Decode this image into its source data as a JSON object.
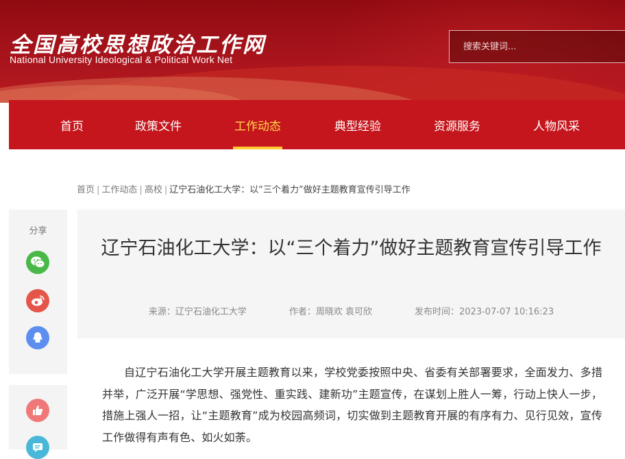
{
  "header": {
    "logo_cn": "全国高校思想政治工作网",
    "logo_en": "National University Ideological & Political Work Net",
    "search_placeholder": "搜索关键词..."
  },
  "nav": {
    "items": [
      {
        "label": "首页"
      },
      {
        "label": "政策文件"
      },
      {
        "label": "工作动态",
        "active": true
      },
      {
        "label": "典型经验"
      },
      {
        "label": "资源服务"
      },
      {
        "label": "人物风采"
      }
    ],
    "active_color": "#ffd84a",
    "bar_color": "#c5161d"
  },
  "breadcrumb": {
    "home": "首页",
    "section": "工作动态",
    "category": "高校",
    "current": "辽宁石油化工大学：以“三个着力”做好主题教育宣传引导工作",
    "separator": "|"
  },
  "share": {
    "label": "分享",
    "icons": [
      "wechat-icon",
      "weibo-icon",
      "qq-icon",
      "thumbs-up-icon",
      "comment-icon"
    ]
  },
  "article": {
    "title": "辽宁石油化工大学：以“三个着力”做好主题教育宣传引导工作",
    "source": "来源：辽宁石油化工大学",
    "author": "作者：周晓欢 袁可欣",
    "published": "发布时间：2023-07-07 10:16:23",
    "paragraph": "自辽宁石油化工大学开展主题教育以来，学校党委按照中央、省委有关部署要求，全面发力、多措并举，广泛开展“学思想、强党性、重实践、建新功”主题宣传，在谋划上胜人一筹，行动上快人一步，措施上强人一招，让“主题教育”成为校园高频词，切实做到主题教育开展的有序有力、见行见效，宣传工作做得有声有色、如火如荼。"
  }
}
